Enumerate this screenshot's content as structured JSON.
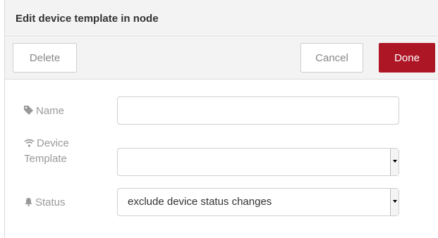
{
  "tray": {
    "title": "Edit device template in node"
  },
  "toolbar": {
    "delete_label": "Delete",
    "cancel_label": "Cancel",
    "done_label": "Done"
  },
  "form": {
    "name": {
      "label": "Name",
      "icon": "tag-icon",
      "value": "",
      "placeholder": ""
    },
    "device_template": {
      "label_line1": "Device",
      "label_line2": "Template",
      "icon": "wifi-icon",
      "selected": ""
    },
    "status": {
      "label": "Status",
      "icon": "bell-icon",
      "selected": "exclude device status changes"
    }
  },
  "colors": {
    "done_bg": "#ad1625",
    "header_bg": "#f3f3f3",
    "label_text": "#999999"
  }
}
